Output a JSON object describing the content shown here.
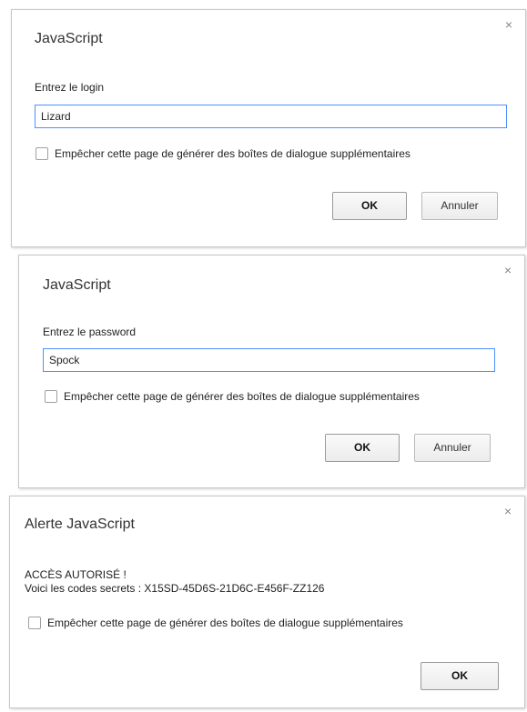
{
  "dialogs": [
    {
      "title": "JavaScript",
      "message": "Entrez le login",
      "input_value": "Lizard",
      "checkbox_label": "Empêcher cette page de générer des boîtes de dialogue supplémentaires",
      "ok_label": "OK",
      "cancel_label": "Annuler"
    },
    {
      "title": "JavaScript",
      "message": "Entrez le password",
      "input_value": "Spock",
      "checkbox_label": "Empêcher cette page de générer des boîtes de dialogue supplémentaires",
      "ok_label": "OK",
      "cancel_label": "Annuler"
    },
    {
      "title": "Alerte JavaScript",
      "message_line1": "ACCÈS AUTORISÉ !",
      "message_line2": "Voici les codes secrets : X15SD-45D6S-21D6C-E456F-ZZ126",
      "checkbox_label": "Empêcher cette page de générer des boîtes de dialogue supplémentaires",
      "ok_label": "OK"
    }
  ],
  "close_glyph": "×",
  "icons": {
    "close": "close-icon"
  },
  "colors": {
    "input_focus_border": "#4d90fe",
    "dialog_border": "#c8c8c8"
  }
}
